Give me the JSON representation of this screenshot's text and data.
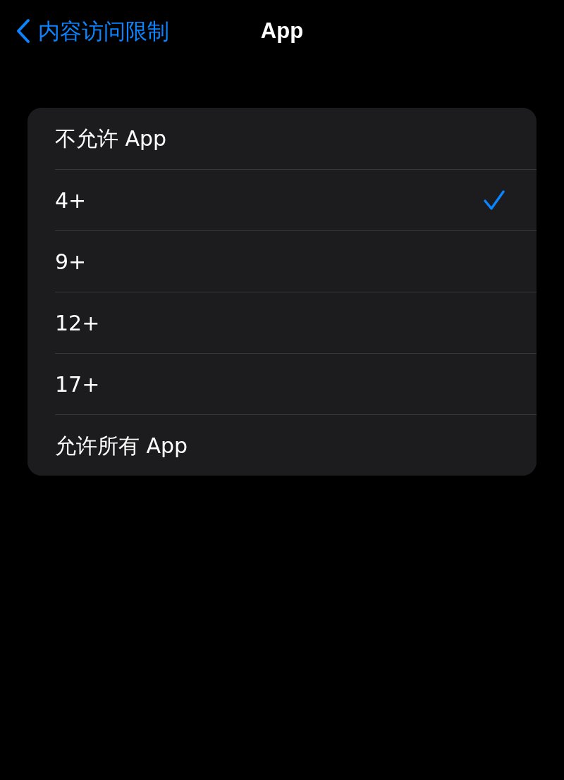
{
  "nav": {
    "back_label": "内容访问限制",
    "title": "App"
  },
  "options": [
    {
      "label": "不允许 App",
      "selected": false
    },
    {
      "label": "4+",
      "selected": true
    },
    {
      "label": "9+",
      "selected": false
    },
    {
      "label": "12+",
      "selected": false
    },
    {
      "label": "17+",
      "selected": false
    },
    {
      "label": "允许所有 App",
      "selected": false
    }
  ]
}
